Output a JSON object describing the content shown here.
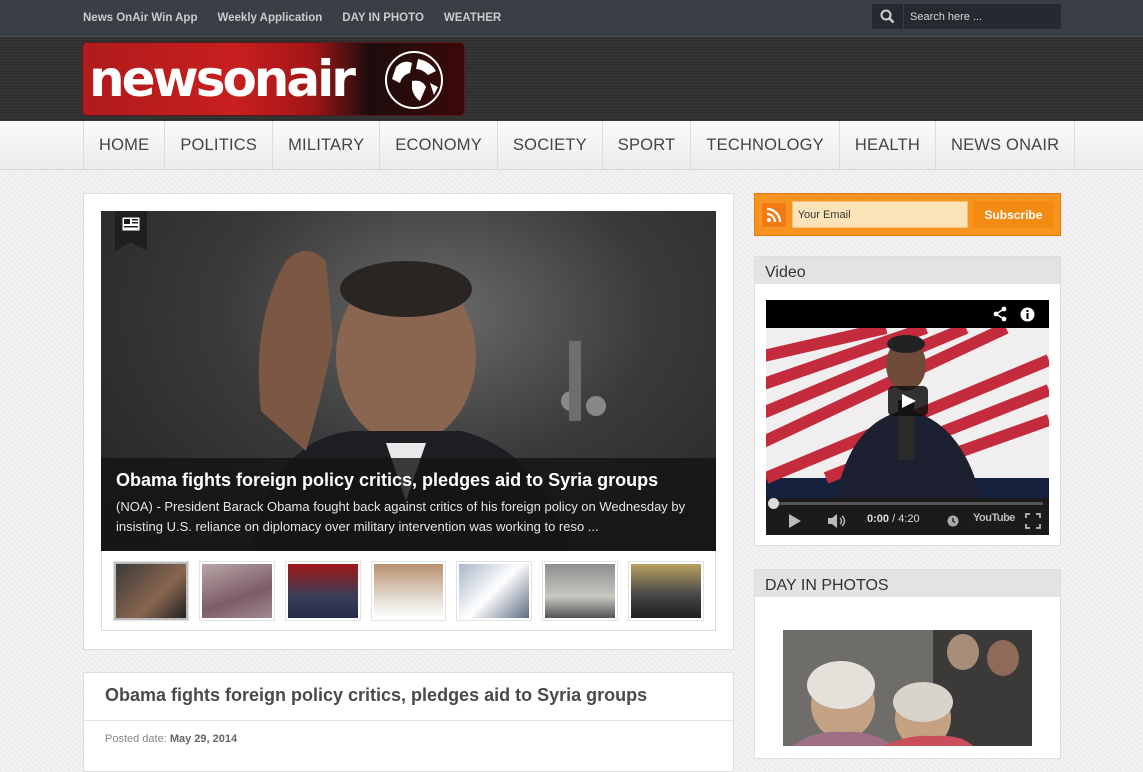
{
  "topbar": {
    "links": [
      "News OnAir Win App",
      "Weekly Application",
      "DAY IN PHOTO",
      "WEATHER"
    ],
    "search_placeholder": "Search here ..."
  },
  "logo": {
    "text": "newsonair"
  },
  "nav": {
    "items": [
      "HOME",
      "POLITICS",
      "MILITARY",
      "ECONOMY",
      "SOCIETY",
      "SPORT",
      "TECHNOLOGY",
      "HEALTH",
      "NEWS ONAIR"
    ]
  },
  "slider": {
    "title": "Obama fights foreign policy critics, pledges aid to Syria groups",
    "excerpt": "(NOA) - President Barack Obama fought back against critics of his foreign policy on Wednesday by insisting U.S. reliance on diplomacy over military intervention was working to reso ...",
    "thumbs": 7
  },
  "article": {
    "title": "Obama fights foreign policy critics, pledges aid to Syria groups",
    "date_label": "Posted date:",
    "date": "May 29, 2014"
  },
  "subscribe": {
    "placeholder": "Your Email",
    "button": "Subscribe"
  },
  "video_widget": {
    "title": "Video",
    "time_current": "0:00",
    "time_sep": " / ",
    "time_total": "4:20",
    "brand": "YouTube"
  },
  "photos_widget": {
    "title": "DAY IN PHOTOS"
  },
  "colors": {
    "accent": "#f8941d",
    "brand_red": "#c81f1f",
    "topbar": "#3a3e45"
  }
}
